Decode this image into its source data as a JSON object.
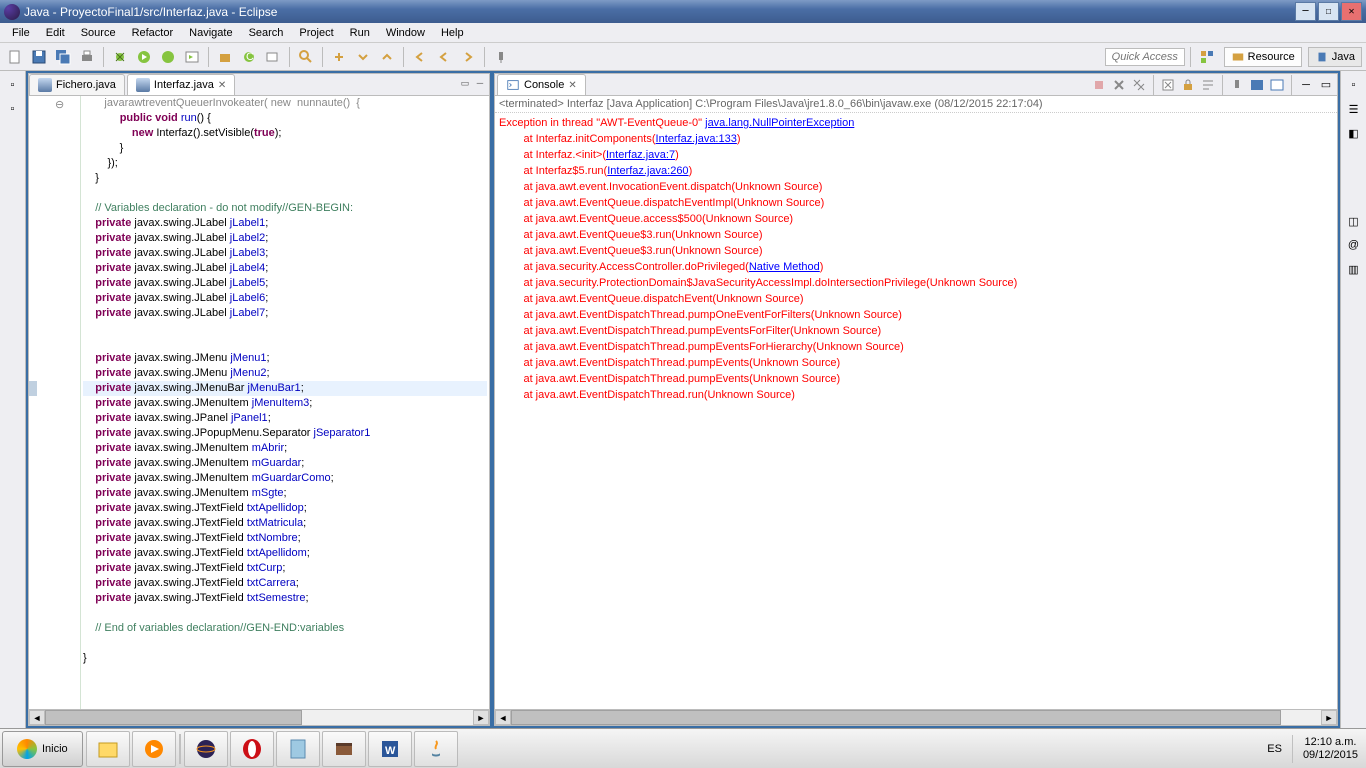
{
  "title": "Java - ProyectoFinal1/src/Interfaz.java - Eclipse",
  "menu": [
    "File",
    "Edit",
    "Source",
    "Refactor",
    "Navigate",
    "Search",
    "Project",
    "Run",
    "Window",
    "Help"
  ],
  "quick_access": "Quick Access",
  "perspectives": {
    "resource": "Resource",
    "java": "Java"
  },
  "tabs": {
    "t1": "Fichero.java",
    "t2": "Interfaz.java"
  },
  "code": {
    "l1": "            public void run() {",
    "l2": "                new Interfaz().setVisible(true);",
    "l3": "            }",
    "l4": "        });",
    "l5": "    }",
    "l6": "",
    "l7": "    // Variables declaration - do not modify//GEN-BEGIN:",
    "l8": "    private javax.swing.JLabel jLabel1;",
    "l9": "    private javax.swing.JLabel jLabel2;",
    "l10": "    private javax.swing.JLabel jLabel3;",
    "l11": "    private javax.swing.JLabel jLabel4;",
    "l12": "    private javax.swing.JLabel jLabel5;",
    "l13": "    private javax.swing.JLabel jLabel6;",
    "l14": "    private javax.swing.JLabel jLabel7;",
    "l15": "",
    "l16": "",
    "l17": "    private javax.swing.JMenu jMenu1;",
    "l18": "    private javax.swing.JMenu jMenu2;",
    "l19": "    private javax.swing.JMenuBar jMenuBar1;",
    "l20": "    private javax.swing.JMenuItem jMenuItem3;",
    "l21": "    private iavax.swing.JPanel jPanel1;",
    "l22": "    private javax.swing.JPopupMenu.Separator jSeparator1",
    "l23": "    private iavax.swing.JMenuItem mAbrir;",
    "l24": "    private javax.swing.JMenuItem mGuardar;",
    "l25": "    private javax.swing.JMenuItem mGuardarComo;",
    "l26": "    private javax.swing.JMenuItem mSgte;",
    "l27": "    private javax.swing.JTextField txtApellidop;",
    "l28": "    private javax.swing.JTextField txtMatricula;",
    "l29": "    private javax.swing.JTextField txtNombre;",
    "l30": "    private javax.swing.JTextField txtApellidom;",
    "l31": "    private javax.swing.JTextField txtCurp;",
    "l32": "    private javax.swing.JTextField txtCarrera;",
    "l33": "    private javax.swing.JTextField txtSemestre;",
    "l34": "",
    "l35": "    // End of variables declaration//GEN-END:variables",
    "l36": "",
    "l37": "}"
  },
  "console": {
    "title": "Console",
    "header": "<terminated> Interfaz [Java Application] C:\\Program Files\\Java\\jre1.8.0_66\\bin\\javaw.exe (08/12/2015 22:17:04)",
    "exc_pre": "Exception in thread \"AWT-EventQueue-0\" ",
    "exc_link": "java.lang.NullPointerException",
    "lines": [
      {
        "pre": "        at Interfaz.initComponents(",
        "link": "Interfaz.java:133",
        "post": ")"
      },
      {
        "pre": "        at Interfaz.<init>(",
        "link": "Interfaz.java:7",
        "post": ")"
      },
      {
        "pre": "        at Interfaz$5.run(",
        "link": "Interfaz.java:260",
        "post": ")"
      },
      {
        "pre": "        at java.awt.event.InvocationEvent.dispatch(Unknown Source)",
        "link": "",
        "post": ""
      },
      {
        "pre": "        at java.awt.EventQueue.dispatchEventImpl(Unknown Source)",
        "link": "",
        "post": ""
      },
      {
        "pre": "        at java.awt.EventQueue.access$500(Unknown Source)",
        "link": "",
        "post": ""
      },
      {
        "pre": "        at java.awt.EventQueue$3.run(Unknown Source)",
        "link": "",
        "post": ""
      },
      {
        "pre": "        at java.awt.EventQueue$3.run(Unknown Source)",
        "link": "",
        "post": ""
      },
      {
        "pre": "        at java.security.AccessController.doPrivileged(",
        "link": "Native Method",
        "post": ")"
      },
      {
        "pre": "        at java.security.ProtectionDomain$JavaSecurityAccessImpl.doIntersectionPrivilege(Unknown Source)",
        "link": "",
        "post": ""
      },
      {
        "pre": "        at java.awt.EventQueue.dispatchEvent(Unknown Source)",
        "link": "",
        "post": ""
      },
      {
        "pre": "        at java.awt.EventDispatchThread.pumpOneEventForFilters(Unknown Source)",
        "link": "",
        "post": ""
      },
      {
        "pre": "        at java.awt.EventDispatchThread.pumpEventsForFilter(Unknown Source)",
        "link": "",
        "post": ""
      },
      {
        "pre": "        at java.awt.EventDispatchThread.pumpEventsForHierarchy(Unknown Source)",
        "link": "",
        "post": ""
      },
      {
        "pre": "        at java.awt.EventDispatchThread.pumpEvents(Unknown Source)",
        "link": "",
        "post": ""
      },
      {
        "pre": "        at java.awt.EventDispatchThread.pumpEvents(Unknown Source)",
        "link": "",
        "post": ""
      },
      {
        "pre": "        at java.awt.EventDispatchThread.run(Unknown Source)",
        "link": "",
        "post": ""
      }
    ]
  },
  "taskbar": {
    "start": "Inicio",
    "lang": "ES",
    "time": "12:10 a.m.",
    "date": "09/12/2015"
  }
}
